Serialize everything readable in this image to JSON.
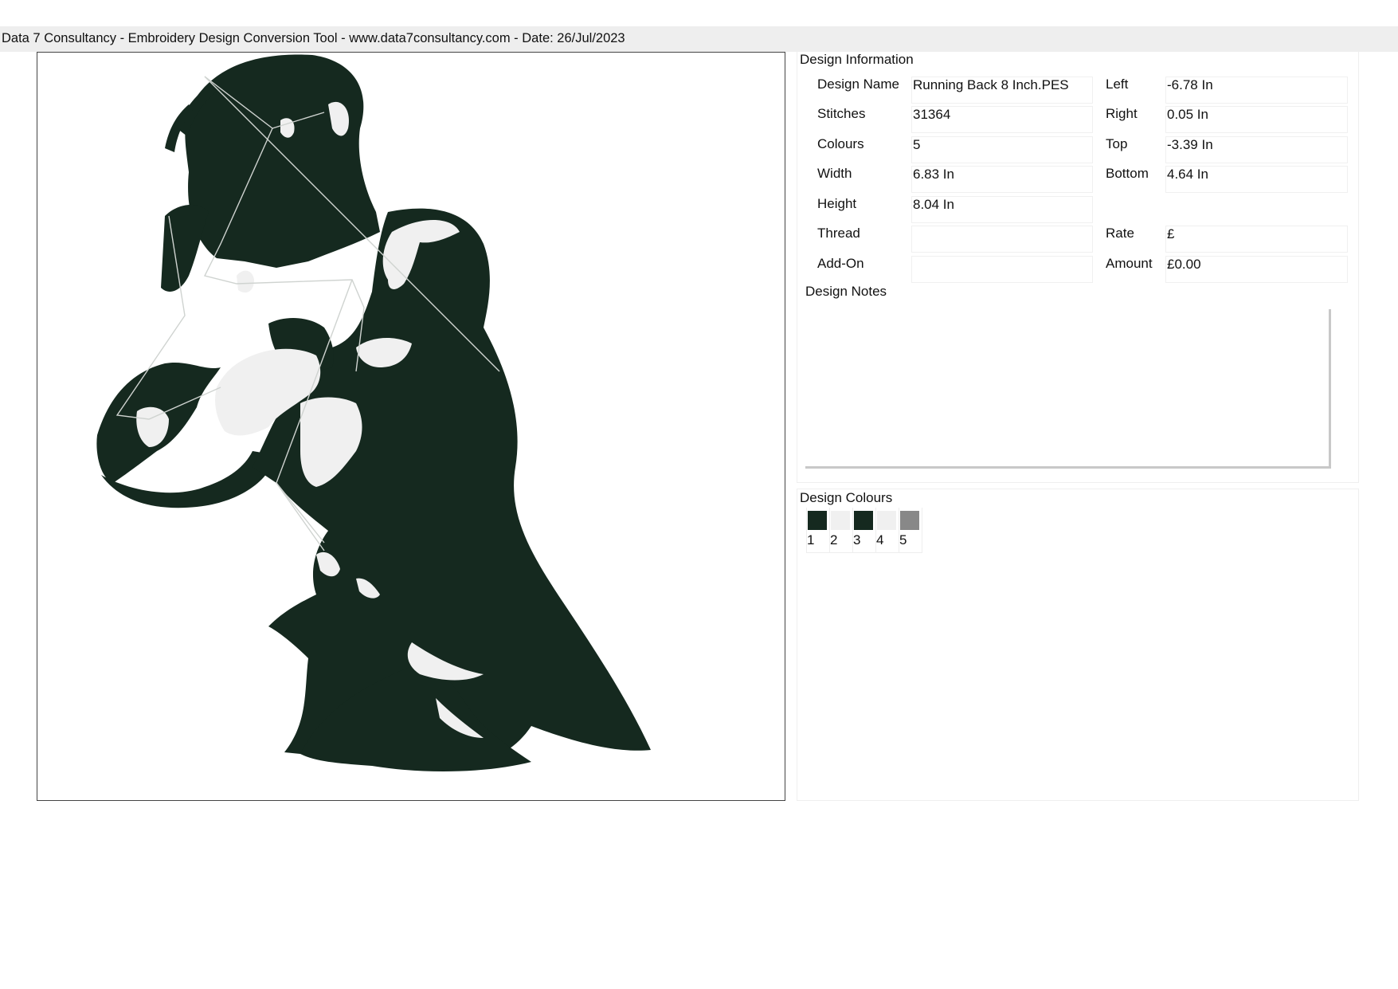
{
  "header": {
    "title": "Data 7 Consultancy - Embroidery Design Conversion Tool - www.data7consultancy.com - Date: 26/Jul/2023"
  },
  "preview": {
    "thread_colour": "#15291f",
    "jump_colour": "#cfd3d0"
  },
  "design_information": {
    "heading": "Design Information",
    "fields": {
      "design_name": {
        "label": "Design Name",
        "value": "Running Back 8 Inch.PES"
      },
      "stitches": {
        "label": "Stitches",
        "value": "31364"
      },
      "colours": {
        "label": "Colours",
        "value": "5"
      },
      "width": {
        "label": "Width",
        "value": "6.83 In"
      },
      "height": {
        "label": "Height",
        "value": "8.04 In"
      },
      "thread": {
        "label": "Thread",
        "value": ""
      },
      "add_on": {
        "label": "Add-On",
        "value": ""
      },
      "left": {
        "label": "Left",
        "value": "-6.78 In"
      },
      "right": {
        "label": "Right",
        "value": "0.05 In"
      },
      "top": {
        "label": "Top",
        "value": "-3.39 In"
      },
      "bottom": {
        "label": "Bottom",
        "value": "4.64 In"
      },
      "rate": {
        "label": "Rate",
        "value": "£"
      },
      "amount": {
        "label": "Amount",
        "value": "£0.00"
      }
    },
    "notes_heading": "Design Notes",
    "notes_value": ""
  },
  "design_colours": {
    "heading": "Design Colours",
    "swatches": [
      {
        "number": "1",
        "color": "#15291f"
      },
      {
        "number": "2",
        "color": "#f0f0f0"
      },
      {
        "number": "3",
        "color": "#15291f"
      },
      {
        "number": "4",
        "color": "#f0f0f0"
      },
      {
        "number": "5",
        "color": "#888888"
      }
    ]
  }
}
